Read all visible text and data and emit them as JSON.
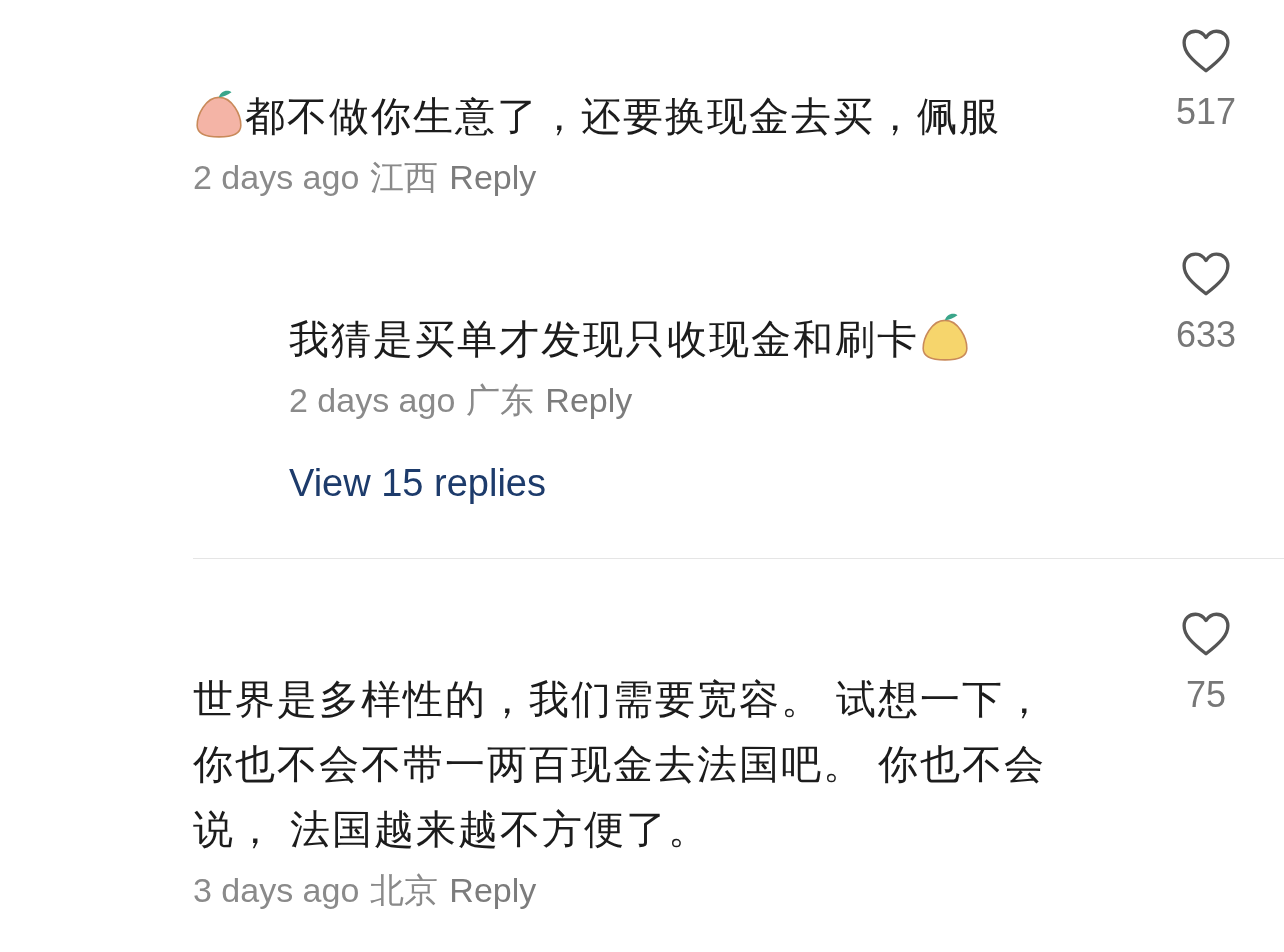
{
  "comments": [
    {
      "kind": "comment",
      "emoji": {
        "kind": "leading",
        "color": "#f4b4a6"
      },
      "text": "都不做你生意了，还要换现金去买，佩服",
      "time": "2 days ago",
      "region": "江西",
      "reply": "Reply",
      "liked": false,
      "likes": "517"
    },
    {
      "kind": "reply",
      "emoji": {
        "kind": "trailing",
        "color": "#f6d56c"
      },
      "text": "我猜是买单才发现只收现金和刷卡",
      "time": "2 days ago",
      "region": "广东",
      "reply": "Reply",
      "liked": false,
      "likes": "633",
      "more": "View 15 replies"
    },
    {
      "kind": "comment",
      "text": "世界是多样性的，我们需要宽容。 试想一下，你也不会不带一两百现金去法国吧。 你也不会说， 法国越来越不方便了。",
      "time": "3 days ago",
      "region": "北京",
      "reply": "Reply",
      "liked": false,
      "likes": "75"
    }
  ]
}
